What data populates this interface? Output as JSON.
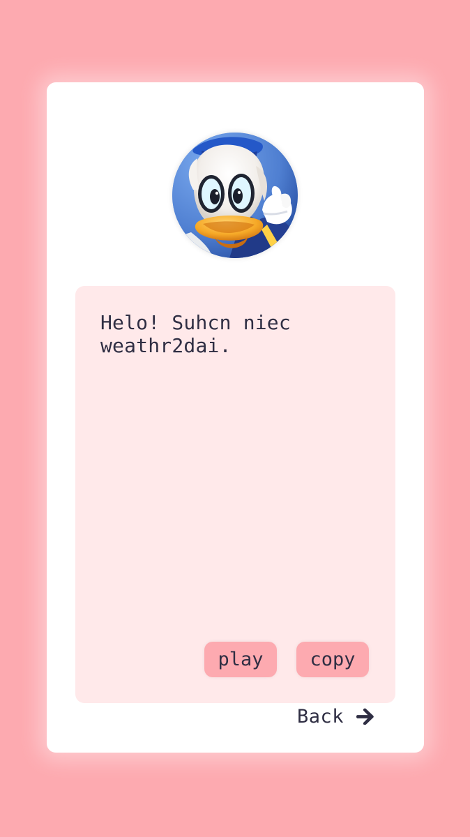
{
  "message": {
    "text": "Helo! Suhcn niec weathr2dai."
  },
  "actions": {
    "play_label": "play",
    "copy_label": "copy"
  },
  "navigation": {
    "back_label": "Back",
    "back_icon": "arrow-right-icon"
  },
  "avatar": {
    "icon": "duck-character-avatar"
  },
  "colors": {
    "background": "#fdaab0",
    "card": "#ffffff",
    "message_panel": "#ffe9ea",
    "text": "#2f2e43",
    "button": "#fdaab0"
  }
}
